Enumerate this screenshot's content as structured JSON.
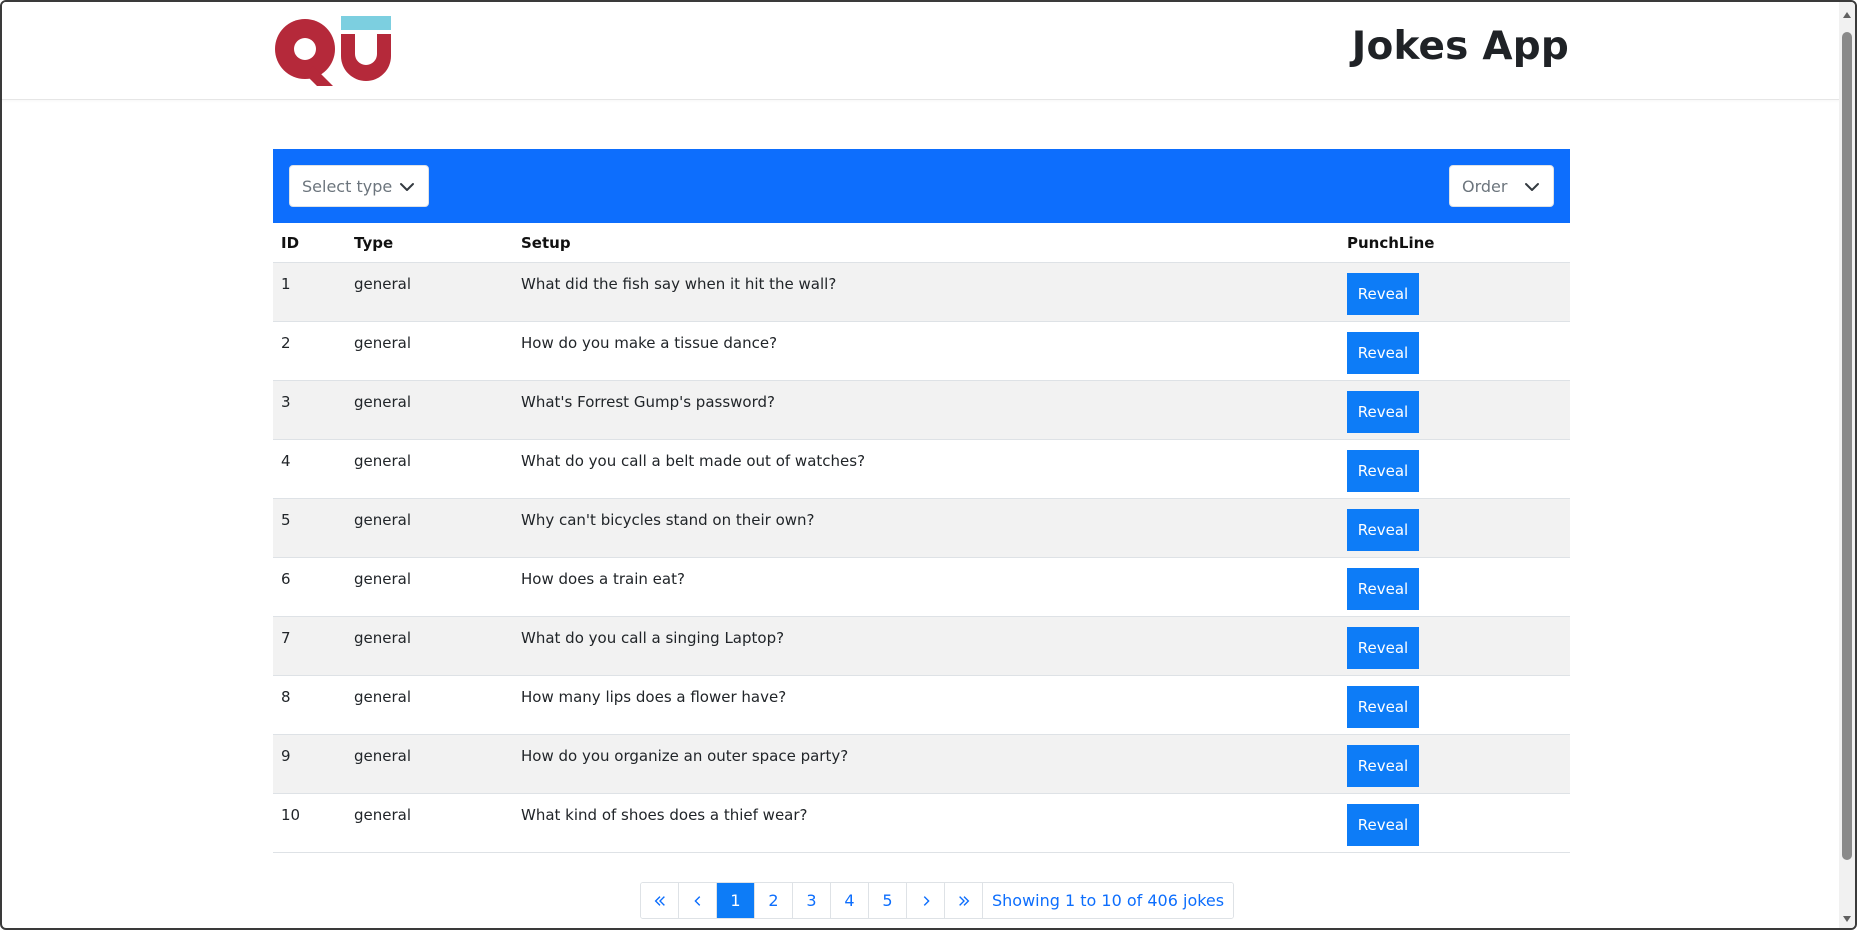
{
  "header": {
    "title": "Jokes App",
    "logo_icon": "qu-logo",
    "logo_colors": {
      "red": "#b5293a",
      "teal": "#7ccfe0"
    }
  },
  "toolbar": {
    "background": "#0d6efd",
    "type_select": {
      "placeholder": "Select type",
      "icon": "chevron-down-icon"
    },
    "order_select": {
      "placeholder": "Order",
      "icon": "chevron-down-icon"
    }
  },
  "table": {
    "headers": {
      "id": "ID",
      "type": "Type",
      "setup": "Setup",
      "punchline": "PunchLine"
    },
    "reveal_label": "Reveal",
    "rows": [
      {
        "id": "1",
        "type": "general",
        "setup": "What did the fish say when it hit the wall?"
      },
      {
        "id": "2",
        "type": "general",
        "setup": "How do you make a tissue dance?"
      },
      {
        "id": "3",
        "type": "general",
        "setup": "What's Forrest Gump's password?"
      },
      {
        "id": "4",
        "type": "general",
        "setup": "What do you call a belt made out of watches?"
      },
      {
        "id": "5",
        "type": "general",
        "setup": "Why can't bicycles stand on their own?"
      },
      {
        "id": "6",
        "type": "general",
        "setup": "How does a train eat?"
      },
      {
        "id": "7",
        "type": "general",
        "setup": "What do you call a singing Laptop?"
      },
      {
        "id": "8",
        "type": "general",
        "setup": "How many lips does a flower have?"
      },
      {
        "id": "9",
        "type": "general",
        "setup": "How do you organize an outer space party?"
      },
      {
        "id": "10",
        "type": "general",
        "setup": "What kind of shoes does a thief wear?"
      }
    ]
  },
  "pagination": {
    "first_icon": "double-chevron-left-icon",
    "prev_icon": "chevron-left-icon",
    "pages": [
      "1",
      "2",
      "3",
      "4",
      "5"
    ],
    "active_page": "1",
    "next_icon": "chevron-right-icon",
    "last_icon": "double-chevron-right-icon",
    "info": "Showing 1 to 10 of 406 jokes"
  },
  "colors": {
    "primary": "#0d6efd",
    "button": "#0d7cf7",
    "stripe": "#f2f2f2"
  }
}
